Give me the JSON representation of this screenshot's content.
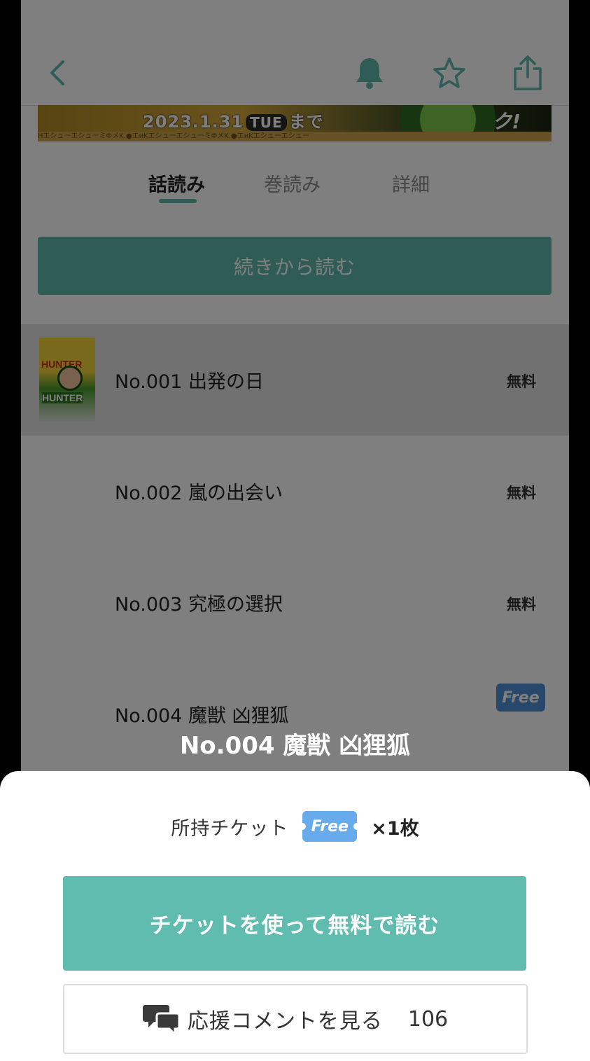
{
  "colors": {
    "accent": "#5fb8a8",
    "free_badge": "#67abec"
  },
  "header": {
    "icons": [
      "back-chevron-icon",
      "bell-icon",
      "star-icon",
      "share-icon"
    ]
  },
  "banner": {
    "date": "2023.1.31",
    "day": "TUE",
    "suffix": "まで",
    "strip_text": "HエシューエシューミФメK.●エиKエシューエシューミФメK.●エиKエシューエシュー"
  },
  "tabs": [
    {
      "label": "話読み",
      "active": true
    },
    {
      "label": "巻読み",
      "active": false
    },
    {
      "label": "詳細",
      "active": false
    }
  ],
  "continue_button": "続きから読む",
  "episodes": [
    {
      "title": "No.001 出発の日",
      "price": "無料",
      "thumb_texts": [
        "HUNTER",
        "HUNTER"
      ]
    },
    {
      "title": "No.002 嵐の出会い",
      "price": "無料"
    },
    {
      "title": "No.003 究極の選択",
      "price": "無料"
    },
    {
      "title": "No.004 魔獣 凶狸狐",
      "badge": "Free"
    }
  ],
  "sheet": {
    "episode_title": "No.004 魔獣 凶狸狐",
    "ticket_label": "所持チケット",
    "ticket_badge": "Free",
    "ticket_count": "×1枚",
    "use_ticket_button": "チケットを使って無料で読む",
    "comment_button_label": "応援コメントを見る",
    "comment_count": "106"
  }
}
